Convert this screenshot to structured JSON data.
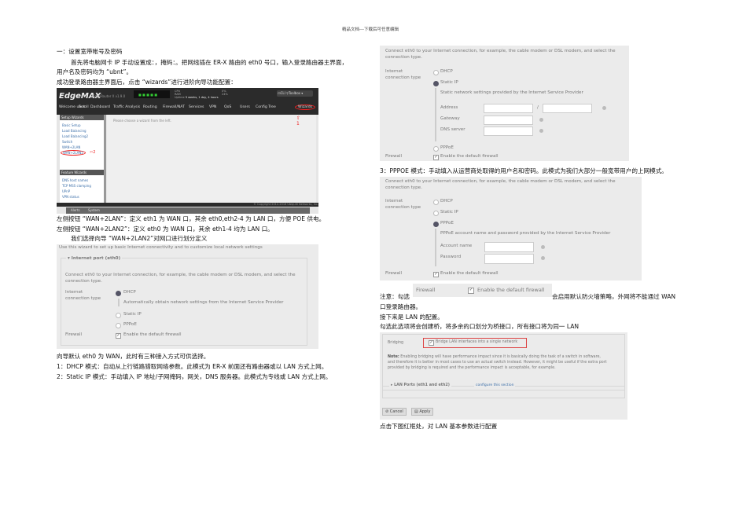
{
  "header": "精品文档---下载后可任意编辑",
  "left": {
    "heading": "一：设置宽带帐号及密码",
    "p1a": "首先将电脑网卡 IP 手动设置成：，掩码：。把网线插在 ER-X 路由的 eth0 号口，输入登录路由器主界面，",
    "p1b": "用户名及密码均为 “ubnt”。",
    "p2": "成功登录路由器主界面后，点击 “wizards”进行进阶向导功能配置：",
    "p3": "左侧按钮 “WAN+2LAN”：定义 eth1 为 WAN 口，其余 eth0,eth2-4 为 LAN 口，方便 POE 供电。",
    "p4": "左侧按钮 “WAN+2LAN2”：定义 eth0 为 WAN 口，其余 eth1-4 均为 LAN 口。",
    "p5": "我们选择向导 “WAN+2LAN2”对网口进行划分定义",
    "p6": "向导默认 eth0 为 WAN，此时有三种接入方式可供选择。",
    "p7": "1：DHCP 模式：自动从上行链路猎取网络参数。此模式为 ER-X 前面还有路由器或以 LAN 方式上网。",
    "p8": "2：Static IP 模式：手动填入 IP 地址/子网掩码，网关，DNS 服务器。此模式为专线或 LAN 方式上网。"
  },
  "edgemax": {
    "logo": "EdgeMAX",
    "model": "EdgeRouter X v1.9.0",
    "stats": {
      "cpu": "CPU",
      "ram": "RAM",
      "uptime_label": "Uptime",
      "uptime": "5 weeks, 1 day, 4 hours",
      "cpu_val": "0%",
      "ram_val": "24%"
    },
    "cli": "CLI",
    "toolbox": "Toolbox",
    "welcome": "Welcome ubnt",
    "scroll": "Scroll",
    "tabs": [
      "Dashboard",
      "Traffic Analysis",
      "Routing",
      "Firewall/NAT",
      "Services",
      "VPN",
      "QoS",
      "Users",
      "Config Tree",
      "Wizards"
    ],
    "setup_title": "Setup Wizards",
    "setup_items": [
      "Basic Setup",
      "Load Balancing",
      "Load Balancing2",
      "Switch",
      "WAN+2LAN",
      "WAN+2LAN2"
    ],
    "feature_title": "Feature Wizards",
    "feature_items": [
      "DNS host names",
      "TCP MSS clamping",
      "UPnP",
      "VPN status"
    ],
    "main_text": "Please choose a wizard from the left.",
    "copyright": "© Copyright 2012-2016 Ubiquiti Networks, Inc.",
    "bottom_tabs": [
      "Alerts",
      "System"
    ],
    "mark1": "1",
    "mark2": "2"
  },
  "wizard": {
    "intro": "Use this wizard to set up basic Internet connectivity and to customize local network settings",
    "section": "▾ Internet port (eth0)",
    "connect": "Connect eth0 to your Internet connection, for example, the cable modem or DSL modem, and select the",
    "connect2": "connection type.",
    "ict1": "Internet",
    "ict2": "connection type",
    "dhcp": "DHCP",
    "dhcp_desc": "Automatically obtain network settings from the Internet Service Provider",
    "static": "Static IP",
    "pppoe": "PPPoE",
    "firewall": "Firewall",
    "firewall_opt": "Enable the default firewall",
    "static_desc": "Static network settings provided by the Internet Service Provider",
    "address": "Address",
    "slash": "/",
    "gateway": "Gateway",
    "dns": "DNS server",
    "pppoe_desc": "PPPoE account name and password provided by the Internet Service Provider",
    "account": "Account name",
    "password": "Password"
  },
  "right": {
    "p3": "3：PPPOE 模式：手动填入从运营商处取得的用户名和密码。此模式为我们大部分一般宽带用户的上网模式。",
    "note_a": "注意：勾选",
    "note_b": "会启用默认防火墙策略，外网将不能通过 WAN",
    "note_c": "口登录路由器。",
    "lan": "接下来是 LAN 的配置。",
    "bridge_txt": "勾选此选项将会创建桥，将多余的口划分为桥接口，所有接口将为同一 LAN",
    "last": "点击下图红框处，对 LAN 基本参数进行配置"
  },
  "bridge": {
    "label": "Bridging",
    "opt": "Bridge LAN interfaces into a single network",
    "note_b": "Note:",
    "note1": " Enabling bridging will have performance impact since it is basically doing the task of a switch in software,",
    "note2": "and therefore it is better in most cases to use an actual switch instead. However, it might be useful if the extra port",
    "note3": "provided by bridging is required and the performance impact is acceptable, for example.",
    "ports": "▸ LAN Ports (eth1 and eth2)",
    "configure": "configure this section",
    "cancel": "⊘ Cancel",
    "apply": "▤ Apply"
  }
}
